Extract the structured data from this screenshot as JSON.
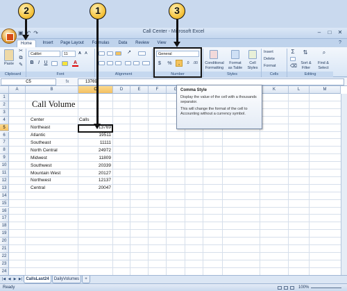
{
  "window": {
    "title": "Call Center - Microsoft Excel"
  },
  "tabs": [
    "Home",
    "Insert",
    "Page Layout",
    "Formulas",
    "Data",
    "Review",
    "View"
  ],
  "ribbon": {
    "clipboard": {
      "paste": "Paste",
      "label": "Clipboard"
    },
    "font": {
      "name": "Calibri",
      "size": "11",
      "label": "Font"
    },
    "alignment": {
      "label": "Alignment"
    },
    "number": {
      "format": "General",
      "currency": "$",
      "percent": "%",
      "comma": ",",
      "label": "Number"
    },
    "styles": {
      "cond_format_1": "Conditional",
      "cond_format_2": "Formatting",
      "format_table_1": "Format",
      "format_table_2": "as Table",
      "cell_styles_1": "Cell",
      "cell_styles_2": "Styles",
      "label": "Styles"
    },
    "cells": {
      "insert": "Insert",
      "delete": "Delete",
      "format": "Format",
      "label": "Cells"
    },
    "editing": {
      "sum": "Σ",
      "sort_1": "Sort &",
      "sort_2": "Filter",
      "find_1": "Find &",
      "find_2": "Select",
      "label": "Editing"
    }
  },
  "formula_bar": {
    "name_box": "C5",
    "fx": "fx",
    "value": "13769"
  },
  "columns": [
    "A",
    "B",
    "C",
    "D",
    "E",
    "F",
    "G",
    "H",
    "I",
    "J",
    "K",
    "L",
    "M"
  ],
  "rows": [
    "1",
    "2",
    "3",
    "4",
    "5",
    "6",
    "7",
    "8",
    "9",
    "10",
    "11",
    "12",
    "13",
    "14",
    "15",
    "16",
    "17",
    "18",
    "19",
    "20",
    "21",
    "22",
    "23",
    "24"
  ],
  "sheet": {
    "title": "Call Volume",
    "header_center": "Center",
    "header_calls": "Calls",
    "data": [
      {
        "center": "Northeast",
        "calls": "13769"
      },
      {
        "center": "Atlantic",
        "calls": "19511"
      },
      {
        "center": "Southeast",
        "calls": "11111"
      },
      {
        "center": "North Central",
        "calls": "24972"
      },
      {
        "center": "Midwest",
        "calls": "11809"
      },
      {
        "center": "Southwest",
        "calls": "20339"
      },
      {
        "center": "Mountain West",
        "calls": "20127"
      },
      {
        "center": "Northwest",
        "calls": "12137"
      },
      {
        "center": "Central",
        "calls": "20047"
      }
    ]
  },
  "tooltip": {
    "title": "Comma Style",
    "body1": "Display the value of the cell with a thousands separator.",
    "body2": "This will change the format of the cell to Accounting without a currency symbol."
  },
  "sheet_tabs": [
    "CallsLast24",
    "DailyVolumes"
  ],
  "status": {
    "ready": "Ready",
    "zoom": "100%"
  },
  "callouts": [
    "1",
    "2",
    "3"
  ]
}
